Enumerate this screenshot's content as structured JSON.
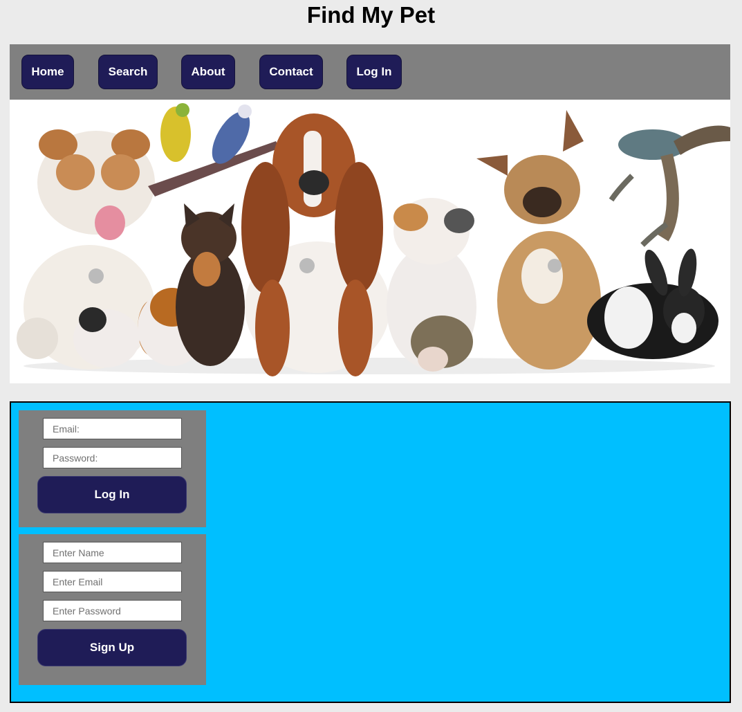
{
  "page": {
    "title": "Find My Pet"
  },
  "nav": {
    "items": [
      {
        "label": "Home"
      },
      {
        "label": "Search"
      },
      {
        "label": "About"
      },
      {
        "label": "Contact"
      },
      {
        "label": "Log In"
      }
    ]
  },
  "login_form": {
    "email_placeholder": "Email:",
    "password_placeholder": "Password:",
    "submit_label": "Log In"
  },
  "signup_form": {
    "name_placeholder": "Enter Name",
    "email_placeholder": "Enter Email",
    "password_placeholder": "Enter Password",
    "submit_label": "Sign Up"
  },
  "colors": {
    "page_background": "#ebebeb",
    "nav_background": "#808080",
    "button_background": "#1f1c57",
    "panel_background": "#00bfff",
    "form_background": "#7f7f7f"
  }
}
